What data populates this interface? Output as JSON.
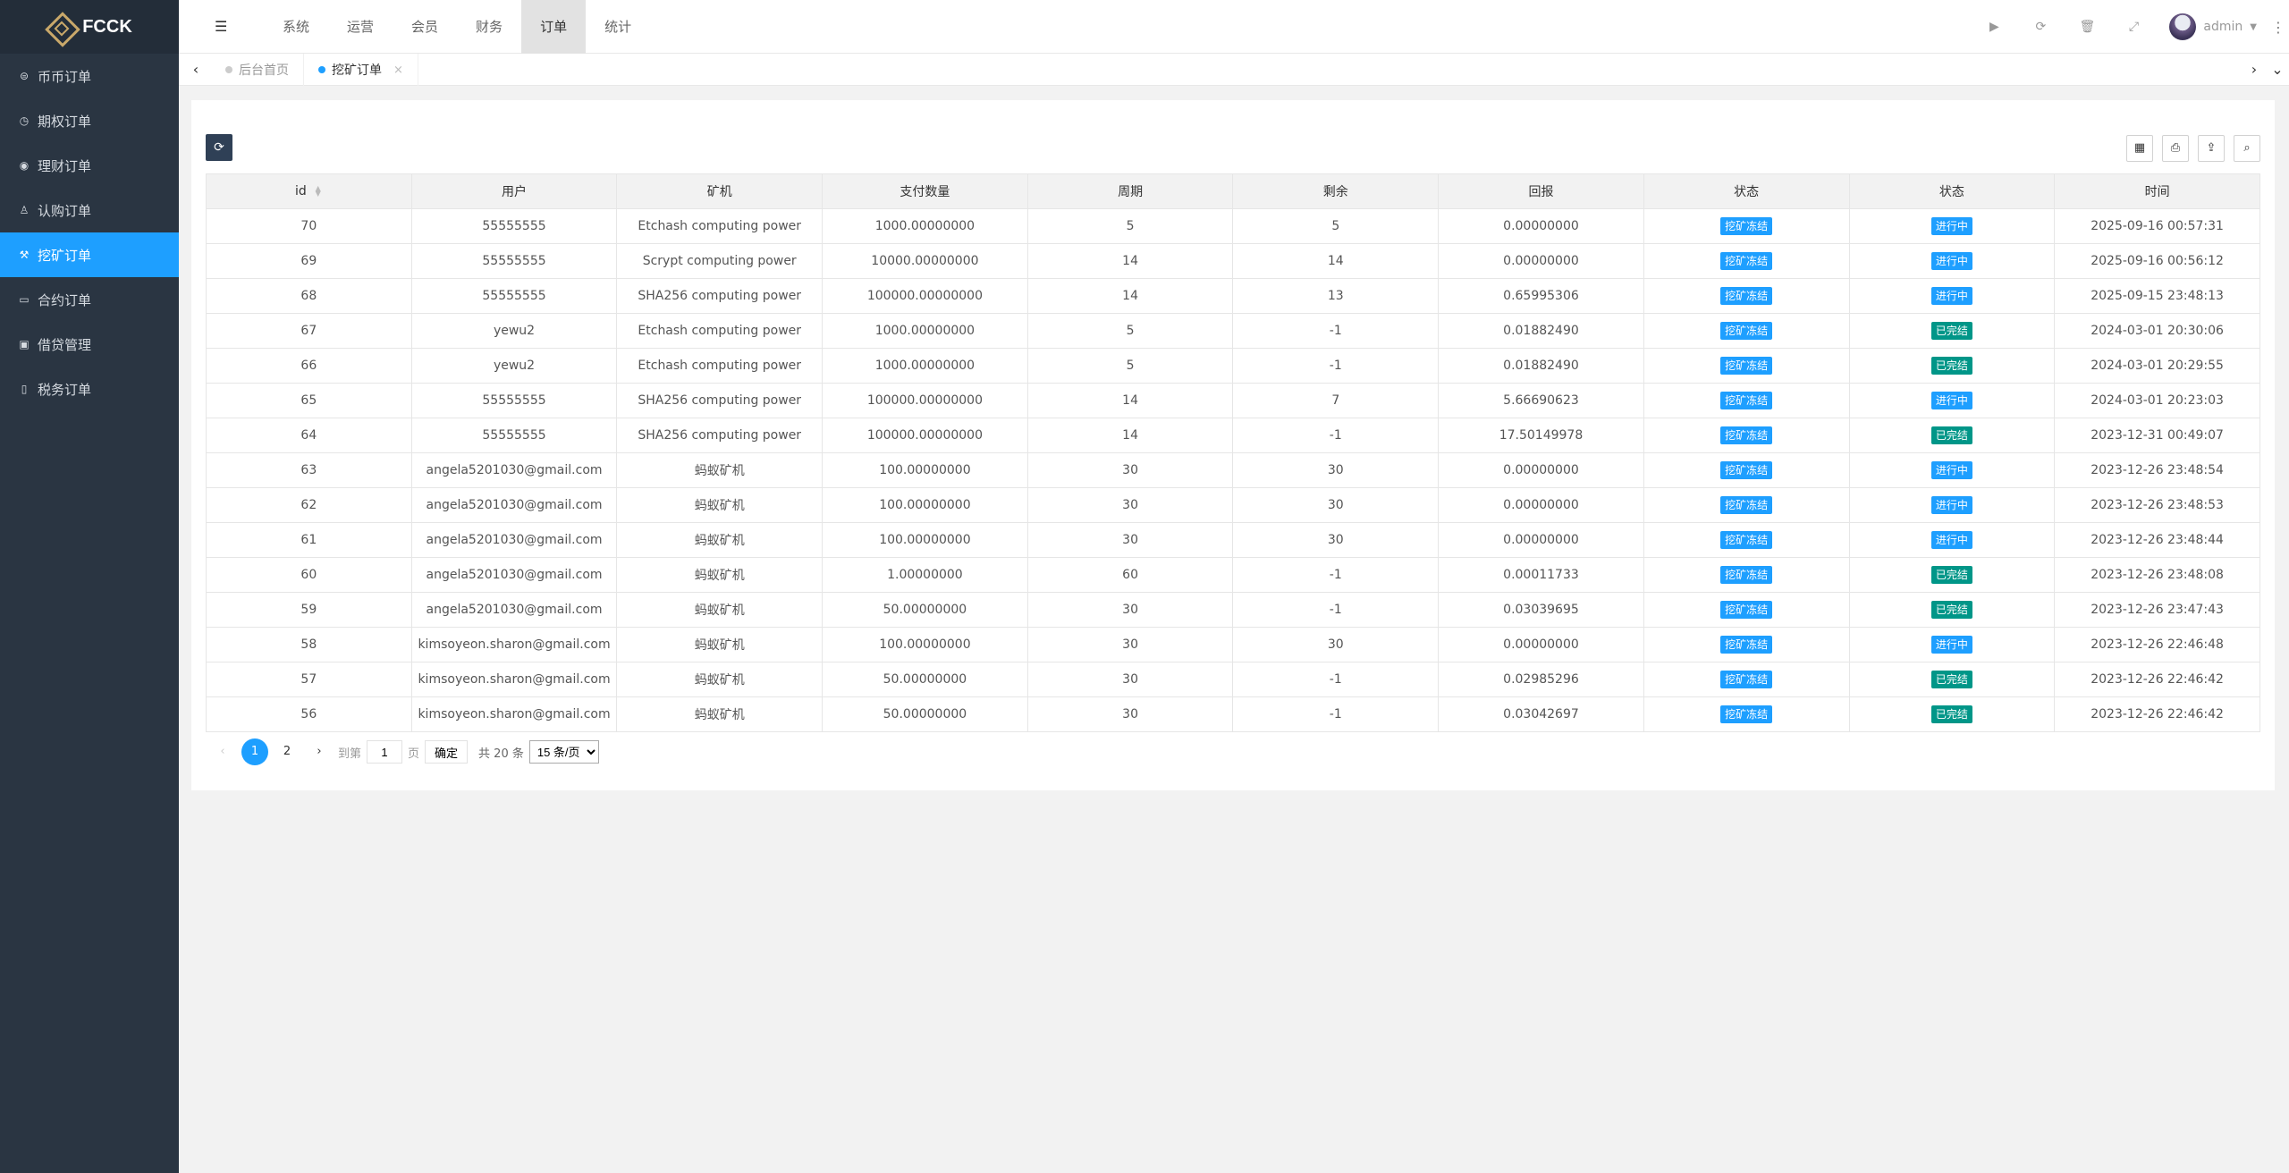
{
  "app": {
    "logo_text": "FCCK"
  },
  "sidebar": {
    "items": [
      {
        "label": "币币订单",
        "icon": "coin-icon",
        "glyph": "⊜",
        "active": false
      },
      {
        "label": "期权订单",
        "icon": "clock-icon",
        "glyph": "◷",
        "active": false
      },
      {
        "label": "理财订单",
        "icon": "finance-icon",
        "glyph": "◉",
        "active": false
      },
      {
        "label": "认购订单",
        "icon": "walk-icon",
        "glyph": "♙",
        "active": false
      },
      {
        "label": "挖矿订单",
        "icon": "mining-icon",
        "glyph": "⚒",
        "active": true
      },
      {
        "label": "合约订单",
        "icon": "monitor-icon",
        "glyph": "▭",
        "active": false
      },
      {
        "label": "借贷管理",
        "icon": "cash-icon",
        "glyph": "▣",
        "active": false
      },
      {
        "label": "税务订单",
        "icon": "phone-icon",
        "glyph": "▯",
        "active": false
      }
    ]
  },
  "topnav": {
    "items": [
      "系统",
      "运营",
      "会员",
      "财务",
      "订单",
      "统计"
    ],
    "active_index": 4
  },
  "header": {
    "username": "admin"
  },
  "tabs": [
    {
      "label": "后台首页",
      "active": false
    },
    {
      "label": "挖矿订单",
      "active": true
    }
  ],
  "table": {
    "columns": [
      "id",
      "用户",
      "矿机",
      "支付数量",
      "周期",
      "剩余",
      "回报",
      "状态",
      "状态",
      "时间"
    ],
    "rows": [
      [
        "70",
        "55555555",
        "Etchash computing power",
        "1000.00000000",
        "5",
        "5",
        "0.00000000",
        "挖矿冻结",
        "进行中",
        "2025-09-16 00:57:31"
      ],
      [
        "69",
        "55555555",
        "Scrypt computing power",
        "10000.00000000",
        "14",
        "14",
        "0.00000000",
        "挖矿冻结",
        "进行中",
        "2025-09-16 00:56:12"
      ],
      [
        "68",
        "55555555",
        "SHA256 computing power",
        "100000.00000000",
        "14",
        "13",
        "0.65995306",
        "挖矿冻结",
        "进行中",
        "2025-09-15 23:48:13"
      ],
      [
        "67",
        "yewu2",
        "Etchash computing power",
        "1000.00000000",
        "5",
        "-1",
        "0.01882490",
        "挖矿冻结",
        "已完结",
        "2024-03-01 20:30:06"
      ],
      [
        "66",
        "yewu2",
        "Etchash computing power",
        "1000.00000000",
        "5",
        "-1",
        "0.01882490",
        "挖矿冻结",
        "已完结",
        "2024-03-01 20:29:55"
      ],
      [
        "65",
        "55555555",
        "SHA256 computing power",
        "100000.00000000",
        "14",
        "7",
        "5.66690623",
        "挖矿冻结",
        "进行中",
        "2024-03-01 20:23:03"
      ],
      [
        "64",
        "55555555",
        "SHA256 computing power",
        "100000.00000000",
        "14",
        "-1",
        "17.50149978",
        "挖矿冻结",
        "已完结",
        "2023-12-31 00:49:07"
      ],
      [
        "63",
        "angela5201030@gmail.com",
        "蚂蚁矿机",
        "100.00000000",
        "30",
        "30",
        "0.00000000",
        "挖矿冻结",
        "进行中",
        "2023-12-26 23:48:54"
      ],
      [
        "62",
        "angela5201030@gmail.com",
        "蚂蚁矿机",
        "100.00000000",
        "30",
        "30",
        "0.00000000",
        "挖矿冻结",
        "进行中",
        "2023-12-26 23:48:53"
      ],
      [
        "61",
        "angela5201030@gmail.com",
        "蚂蚁矿机",
        "100.00000000",
        "30",
        "30",
        "0.00000000",
        "挖矿冻结",
        "进行中",
        "2023-12-26 23:48:44"
      ],
      [
        "60",
        "angela5201030@gmail.com",
        "蚂蚁矿机",
        "1.00000000",
        "60",
        "-1",
        "0.00011733",
        "挖矿冻结",
        "已完结",
        "2023-12-26 23:48:08"
      ],
      [
        "59",
        "angela5201030@gmail.com",
        "蚂蚁矿机",
        "50.00000000",
        "30",
        "-1",
        "0.03039695",
        "挖矿冻结",
        "已完结",
        "2023-12-26 23:47:43"
      ],
      [
        "58",
        "kimsoyeon.sharon@gmail.com",
        "蚂蚁矿机",
        "100.00000000",
        "30",
        "30",
        "0.00000000",
        "挖矿冻结",
        "进行中",
        "2023-12-26 22:46:48"
      ],
      [
        "57",
        "kimsoyeon.sharon@gmail.com",
        "蚂蚁矿机",
        "50.00000000",
        "30",
        "-1",
        "0.02985296",
        "挖矿冻结",
        "已完结",
        "2023-12-26 22:46:42"
      ],
      [
        "56",
        "kimsoyeon.sharon@gmail.com",
        "蚂蚁矿机",
        "50.00000000",
        "30",
        "-1",
        "0.03042697",
        "挖矿冻结",
        "已完结",
        "2023-12-26 22:46:42"
      ]
    ]
  },
  "status_colors": {
    "进行中": "#1e9fff",
    "已完结": "#009688",
    "挖矿冻结": "#1e9fff"
  },
  "pagination": {
    "prev": "‹",
    "pages": [
      "1",
      "2"
    ],
    "current": "1",
    "next": "›",
    "goto_label": "到第",
    "goto_value": "1",
    "page_unit": "页",
    "confirm": "确定",
    "total": "共 20 条",
    "page_size": "15 条/页"
  }
}
